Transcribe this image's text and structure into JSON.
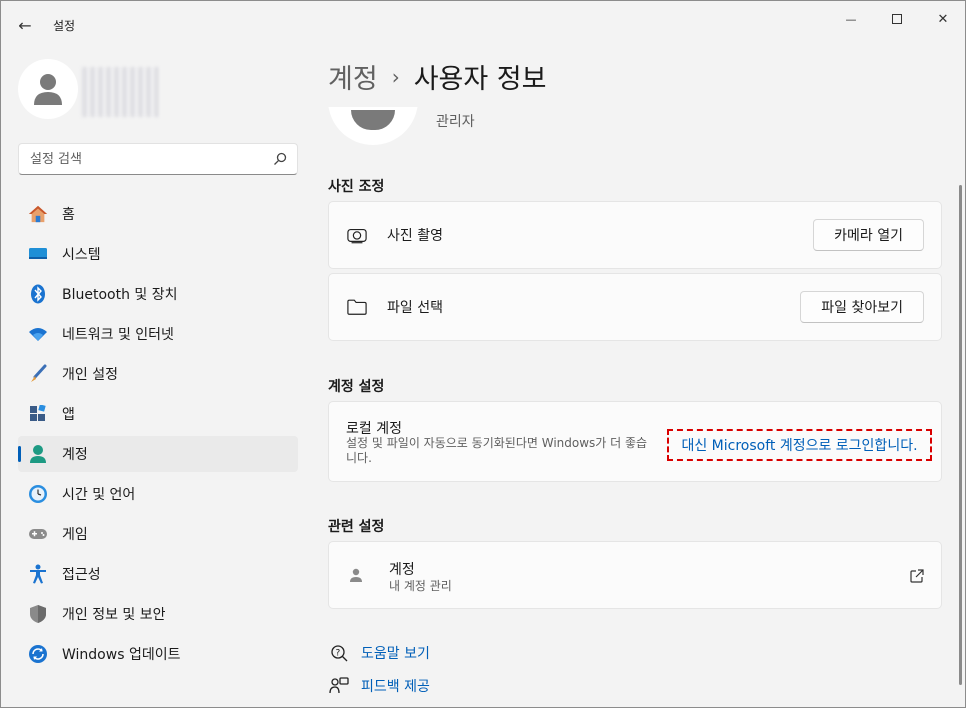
{
  "window": {
    "title": "설정",
    "back_glyph": "←",
    "min_glyph": "—",
    "max_glyph": "☐",
    "close_glyph": "✕"
  },
  "sidebar": {
    "search_placeholder": "설정 검색",
    "items": [
      {
        "label": "홈",
        "icon": "home-icon"
      },
      {
        "label": "시스템",
        "icon": "system-icon"
      },
      {
        "label": "Bluetooth 및 장치",
        "icon": "bluetooth-icon"
      },
      {
        "label": "네트워크 및 인터넷",
        "icon": "wifi-icon"
      },
      {
        "label": "개인 설정",
        "icon": "brush-icon"
      },
      {
        "label": "앱",
        "icon": "apps-icon"
      },
      {
        "label": "계정",
        "icon": "account-icon",
        "active": true
      },
      {
        "label": "시간 및 언어",
        "icon": "clock-globe-icon"
      },
      {
        "label": "게임",
        "icon": "gamepad-icon"
      },
      {
        "label": "접근성",
        "icon": "accessibility-icon"
      },
      {
        "label": "개인 정보 및 보안",
        "icon": "shield-icon"
      },
      {
        "label": "Windows 업데이트",
        "icon": "update-icon"
      }
    ]
  },
  "main": {
    "breadcrumb": {
      "parent": "계정",
      "separator": "›",
      "current": "사용자 정보"
    },
    "role": "관리자",
    "photo_section": {
      "title": "사진 조정",
      "take_photo_label": "사진 촬영",
      "open_camera_button": "카메라 열기",
      "choose_file_label": "파일 선택",
      "browse_files_button": "파일 찾아보기"
    },
    "account_section": {
      "title": "계정 설정",
      "local_account_title": "로컬 계정",
      "local_account_desc": "설정 및 파일이 자동으로 동기화된다면 Windows가 더 좋습니다.",
      "ms_signin_link": "대신 Microsoft 계정으로 로그인합니다."
    },
    "related_section": {
      "title": "관련 설정",
      "accounts_title": "계정",
      "accounts_subtitle": "내 계정 관리"
    },
    "help_links": {
      "get_help": "도움말 보기",
      "give_feedback": "피드백 제공"
    }
  },
  "colors": {
    "accent": "#005fb8",
    "highlight_border": "#d90000",
    "background": "#f3f3f3",
    "card": "#fbfbfb"
  }
}
